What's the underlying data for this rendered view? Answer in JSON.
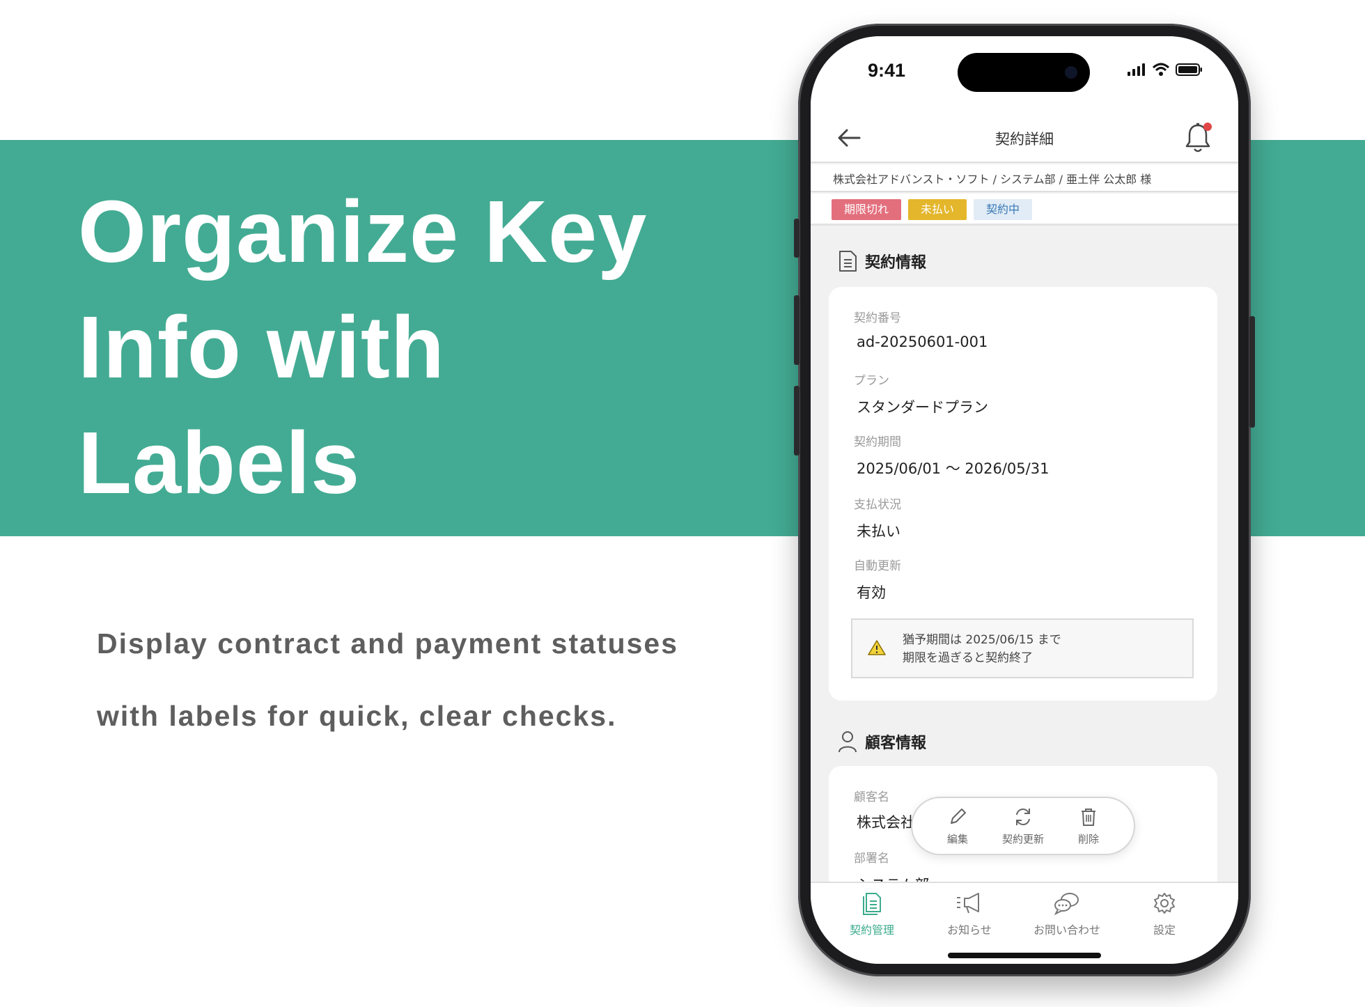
{
  "promo": {
    "headline_lines": [
      "Organize Key",
      "Info with",
      "Labels"
    ],
    "sub_lines": [
      "Display contract and payment statuses",
      "with labels for quick, clear checks."
    ],
    "band_color": "#43ab93"
  },
  "status_bar": {
    "time": "9:41",
    "icons": [
      "signal-icon",
      "wifi-icon",
      "battery-icon"
    ]
  },
  "nav": {
    "title": "契約詳細",
    "back_icon": "arrow-left-icon",
    "bell_icon": "bell-icon",
    "has_notification": true
  },
  "breadcrumb": "株式会社アドバンスト・ソフト / システム部 / 亜土伴 公太郎 様",
  "labels": [
    {
      "text": "期限切れ",
      "color": "#e36f7d"
    },
    {
      "text": "未払い",
      "color": "#e4b62b"
    },
    {
      "text": "契約中",
      "color": "#e1ecf6"
    }
  ],
  "contract_section": {
    "title": "契約情報",
    "icon": "document-icon",
    "fields": [
      {
        "label": "契約番号",
        "value": "ad-20250601-001"
      },
      {
        "label": "プラン",
        "value": "スタンダードプラン"
      },
      {
        "label": "契約期間",
        "value": "2025/06/01 ～ 2026/05/31"
      },
      {
        "label": "支払状況",
        "value": "未払い"
      },
      {
        "label": "自動更新",
        "value": "有効"
      }
    ],
    "notice": {
      "icon": "warning-icon",
      "line1": "猶予期間は 2025/06/15 まで",
      "line2": "期限を過ぎると契約終了"
    }
  },
  "customer_section": {
    "title": "顧客情報",
    "icon": "user-icon",
    "fields": [
      {
        "label": "顧客名",
        "value": "株式会社ア"
      },
      {
        "label": "部署名",
        "value": "システム部"
      }
    ]
  },
  "actions": [
    {
      "label": "編集",
      "icon": "pencil-icon"
    },
    {
      "label": "契約更新",
      "icon": "refresh-icon"
    },
    {
      "label": "削除",
      "icon": "trash-icon"
    }
  ],
  "tabs": [
    {
      "label": "契約管理",
      "icon": "contract-icon",
      "active": true
    },
    {
      "label": "お知らせ",
      "icon": "megaphone-icon",
      "active": false
    },
    {
      "label": "お問い合わせ",
      "icon": "chat-icon",
      "active": false
    },
    {
      "label": "設定",
      "icon": "gear-icon",
      "active": false
    }
  ],
  "accent_color": "#3cab8d"
}
